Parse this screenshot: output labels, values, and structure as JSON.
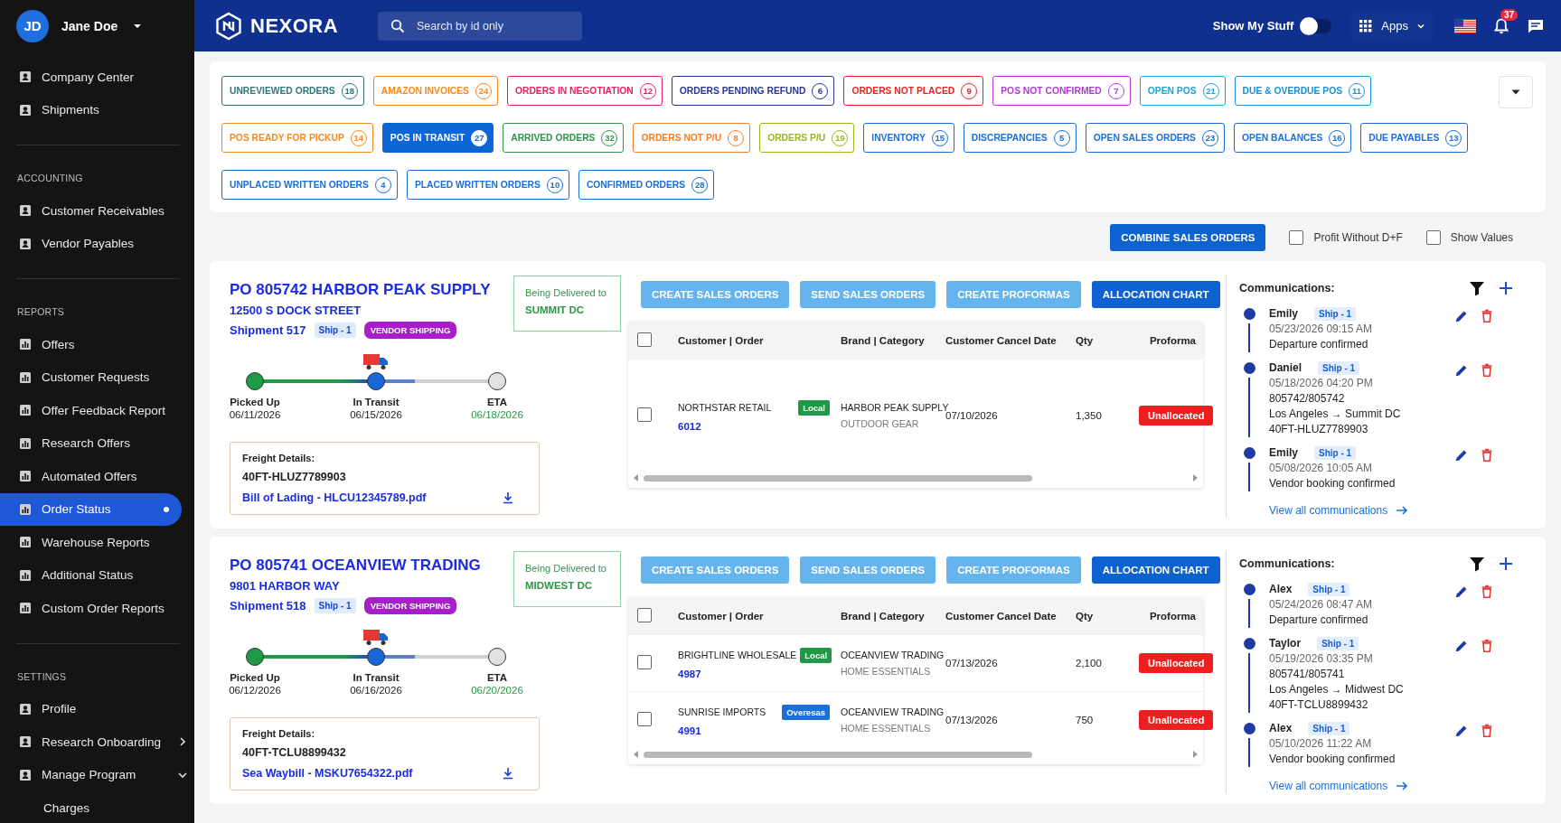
{
  "sidebar": {
    "user": {
      "initials": "JD",
      "name": "Jane Doe"
    },
    "sections": [
      {
        "items": [
          {
            "label": "Company Center",
            "kind": "page",
            "selected": false
          },
          {
            "label": "Shipments",
            "kind": "page",
            "selected": false
          }
        ]
      },
      {
        "heading": "ACCOUNTING",
        "items": [
          {
            "label": "Customer Receivables",
            "kind": "page",
            "selected": false
          },
          {
            "label": "Vendor Payables",
            "kind": "page",
            "selected": false
          }
        ]
      },
      {
        "heading": "REPORTS",
        "items": [
          {
            "label": "Offers",
            "kind": "report",
            "selected": false
          },
          {
            "label": "Customer Requests",
            "kind": "report",
            "selected": false
          },
          {
            "label": "Offer Feedback Report",
            "kind": "report",
            "selected": false
          },
          {
            "label": "Research Offers",
            "kind": "report",
            "selected": false
          },
          {
            "label": "Automated Offers",
            "kind": "report",
            "selected": false
          },
          {
            "label": "Order Status",
            "kind": "report",
            "selected": true
          },
          {
            "label": "Warehouse Reports",
            "kind": "report",
            "selected": false
          },
          {
            "label": "Additional Status",
            "kind": "report",
            "selected": false
          },
          {
            "label": "Custom Order Reports",
            "kind": "report",
            "selected": false
          }
        ]
      },
      {
        "heading": "SETTINGS",
        "items": [
          {
            "label": "Profile",
            "kind": "page",
            "selected": false
          },
          {
            "label": "Research Onboarding",
            "kind": "page",
            "selected": false,
            "expanded": false
          },
          {
            "label": "Manage Program",
            "kind": "page",
            "selected": false,
            "expanded": true,
            "children": [
              {
                "label": "Charges",
                "selected": false
              }
            ]
          }
        ]
      }
    ]
  },
  "topbar": {
    "brand": "NEXORA",
    "search": {
      "placeholder": "Search by id only"
    },
    "show_my_stuff": {
      "label": "Show My Stuff",
      "on": false
    },
    "apps": {
      "label": "Apps"
    },
    "notifications": {
      "count": "37"
    }
  },
  "filters": {
    "chips": [
      {
        "label": "UNREVIEWED ORDERS",
        "count": "18",
        "color": "#2f7679",
        "selected": false
      },
      {
        "label": "AMAZON INVOICES",
        "count": "24",
        "color": "#f28a1e",
        "selected": false
      },
      {
        "label": "ORDERS IN NEGOTIATION",
        "count": "12",
        "color": "#ea1f63",
        "selected": false
      },
      {
        "label": "ORDERS PENDING REFUND",
        "count": "6",
        "color": "#283593",
        "selected": false
      },
      {
        "label": "ORDERS NOT PLACED",
        "count": "9",
        "color": "#f01f1f",
        "selected": false
      },
      {
        "label": "POS NOT CONFIRMED",
        "count": "7",
        "color": "#b238d6",
        "selected": false
      },
      {
        "label": "OPEN POS",
        "count": "21",
        "color": "#1fa2d6",
        "selected": false
      },
      {
        "label": "DUE & OVERDUE POS",
        "count": "11",
        "color": "#1a8fd6",
        "selected": false
      },
      {
        "label": "POS READY FOR PICKUP",
        "count": "14",
        "color": "#f28a1e",
        "selected": false
      },
      {
        "label": "POS IN TRANSIT",
        "count": "27",
        "color": "#0d66d6",
        "selected": true
      },
      {
        "label": "ARRIVED ORDERS",
        "count": "32",
        "color": "#2e9548",
        "selected": false
      },
      {
        "label": "ORDERS NOT P/U",
        "count": "8",
        "color": "#f0802a",
        "selected": false
      },
      {
        "label": "ORDERS P/U",
        "count": "19",
        "color": "#98b71c",
        "selected": false
      },
      {
        "label": "INVENTORY",
        "count": "15",
        "color": "#1a6fd8",
        "selected": false
      },
      {
        "label": "DISCREPANCIES",
        "count": "5",
        "color": "#1a6fd8",
        "selected": false
      },
      {
        "label": "OPEN SALES ORDERS",
        "count": "23",
        "color": "#1a6fd8",
        "selected": false
      },
      {
        "label": "OPEN BALANCES",
        "count": "16",
        "color": "#1a6fd8",
        "selected": false
      },
      {
        "label": "DUE PAYABLES",
        "count": "13",
        "color": "#1a6fd8",
        "selected": false
      },
      {
        "label": "UNPLACED WRITTEN ORDERS",
        "count": "4",
        "color": "#1a6fd8",
        "selected": false
      },
      {
        "label": "PLACED WRITTEN ORDERS",
        "count": "10",
        "color": "#1a6fd8",
        "selected": false
      },
      {
        "label": "CONFIRMED ORDERS",
        "count": "28",
        "color": "#1a6fd8",
        "selected": false
      }
    ]
  },
  "toolbar": {
    "combine_button": "COMBINE SALES ORDERS",
    "checkboxes": [
      {
        "label": "Profit Without D+F",
        "checked": false
      },
      {
        "label": "Show Values",
        "checked": false
      }
    ]
  },
  "shipments": [
    {
      "title": "PO 805742 HARBOR PEAK SUPPLY",
      "address": "12500 S DOCK STREET",
      "shipment": "Shipment 517",
      "ship_tag": "Ship - 1",
      "shipping_tag": "VENDOR SHIPPING",
      "delivery": {
        "label": "Being Delivered to",
        "destination": "SUMMIT DC"
      },
      "progress": [
        {
          "label": "Picked Up",
          "date": "06/11/2026",
          "completed": true,
          "current": false
        },
        {
          "label": "In Transit",
          "date": "06/15/2026",
          "completed": false,
          "current": true
        },
        {
          "label": "ETA",
          "date": "06/18/2026",
          "completed": false,
          "current": false
        }
      ],
      "freight": {
        "heading": "Freight Details:",
        "container": "40FT-HLUZ7789903",
        "document": "Bill of Lading - HLCU12345789.pdf"
      },
      "actions": [
        {
          "label": "CREATE SALES ORDERS",
          "disabled": true
        },
        {
          "label": "SEND SALES ORDERS",
          "disabled": true
        },
        {
          "label": "CREATE PROFORMAS",
          "disabled": true
        },
        {
          "label": "ALLOCATION CHART",
          "disabled": false
        }
      ],
      "table": {
        "all_checked": false,
        "columns": [
          "Customer | Order",
          "Brand | Category",
          "Customer Cancel Date",
          "Qty",
          "Proforma"
        ],
        "rows": [
          {
            "checked": false,
            "customer": "NORTHSTAR RETAIL",
            "tag": {
              "label": "Local",
              "kind": "local"
            },
            "order": "6012",
            "brand": "HARBOR PEAK SUPPLY",
            "category": "OUTDOOR GEAR",
            "cancel_date": "07/10/2026",
            "qty": "1,350",
            "proforma": "Unallocated"
          }
        ]
      },
      "communications": {
        "title": "Communications:",
        "entries": [
          {
            "author": "Emily",
            "tag": "Ship - 1",
            "time": "05/23/2026 09:15 AM",
            "lines": [
              "Departure confirmed"
            ]
          },
          {
            "author": "Daniel",
            "tag": "Ship - 1",
            "time": "05/18/2026 04:20 PM",
            "lines": [
              "805742/805742",
              "Los Angeles → Summit DC",
              "40FT-HLUZ7789903"
            ]
          },
          {
            "author": "Emily",
            "tag": "Ship - 1",
            "time": "05/08/2026 10:05 AM",
            "lines": [
              "Vendor booking confirmed"
            ]
          }
        ],
        "link": "View all communications"
      }
    },
    {
      "title": "PO 805741 OCEANVIEW TRADING",
      "address": "9801 HARBOR WAY",
      "shipment": "Shipment 518",
      "ship_tag": "Ship - 1",
      "shipping_tag": "VENDOR SHIPPING",
      "delivery": {
        "label": "Being Delivered to",
        "destination": "MIDWEST DC"
      },
      "progress": [
        {
          "label": "Picked Up",
          "date": "06/12/2026",
          "completed": true,
          "current": false
        },
        {
          "label": "In Transit",
          "date": "06/16/2026",
          "completed": false,
          "current": true
        },
        {
          "label": "ETA",
          "date": "06/20/2026",
          "completed": false,
          "current": false
        }
      ],
      "freight": {
        "heading": "Freight Details:",
        "container": "40FT-TCLU8899432",
        "document": "Sea Waybill - MSKU7654322.pdf"
      },
      "actions": [
        {
          "label": "CREATE SALES ORDERS",
          "disabled": true
        },
        {
          "label": "SEND SALES ORDERS",
          "disabled": true
        },
        {
          "label": "CREATE PROFORMAS",
          "disabled": true
        },
        {
          "label": "ALLOCATION CHART",
          "disabled": false
        }
      ],
      "table": {
        "all_checked": false,
        "columns": [
          "Customer | Order",
          "Brand | Category",
          "Customer Cancel Date",
          "Qty",
          "Proforma"
        ],
        "rows": [
          {
            "checked": false,
            "customer": "BRIGHTLINE WHOLESALE",
            "tag": {
              "label": "Local",
              "kind": "local"
            },
            "order": "4987",
            "brand": "OCEANVIEW TRADING",
            "category": "HOME ESSENTIALS",
            "cancel_date": "07/13/2026",
            "qty": "2,100",
            "proforma": "Unallocated"
          },
          {
            "checked": false,
            "customer": "SUNRISE IMPORTS",
            "tag": {
              "label": "Overesas",
              "kind": "overseas"
            },
            "order": "4991",
            "brand": "OCEANVIEW TRADING",
            "category": "HOME ESSENTIALS",
            "cancel_date": "07/13/2026",
            "qty": "750",
            "proforma": "Unallocated"
          }
        ]
      },
      "communications": {
        "title": "Communications:",
        "entries": [
          {
            "author": "Alex",
            "tag": "Ship - 1",
            "time": "05/24/2026 08:47 AM",
            "lines": [
              "Departure confirmed"
            ]
          },
          {
            "author": "Taylor",
            "tag": "Ship - 1",
            "time": "05/19/2026 03:35 PM",
            "lines": [
              "805741/805741",
              "Los Angeles → Midwest DC",
              "40FT-TCLU8899432"
            ]
          },
          {
            "author": "Alex",
            "tag": "Ship - 1",
            "time": "05/10/2026 11:22 AM",
            "lines": [
              "Vendor booking confirmed"
            ]
          }
        ],
        "link": "View all communications"
      }
    }
  ]
}
